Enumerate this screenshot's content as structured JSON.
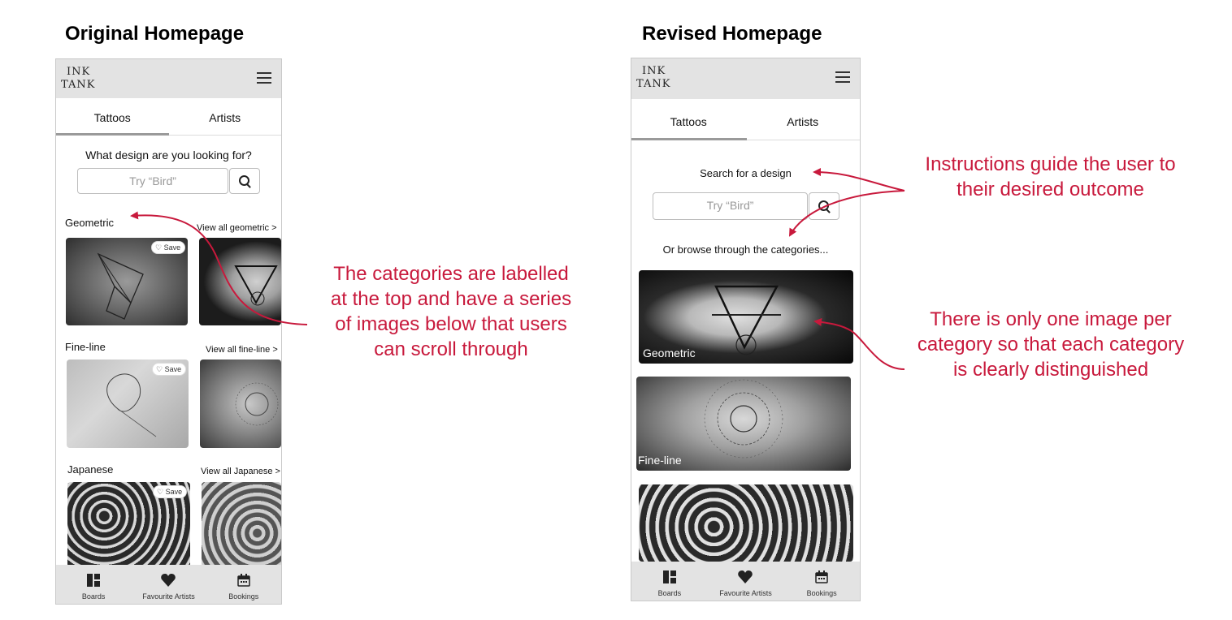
{
  "headings": {
    "original": "Original Homepage",
    "revised": "Revised Homepage"
  },
  "app": {
    "logo_line1": "INK",
    "logo_line2": "TANK",
    "menu_icon": "hamburger-menu-icon",
    "tabs": [
      "Tattoos",
      "Artists"
    ],
    "bottom_nav": [
      {
        "label": "Boards",
        "icon": "boards-grid-icon"
      },
      {
        "label": "Favourite Artists",
        "icon": "heart-icon"
      },
      {
        "label": "Bookings",
        "icon": "calendar-icon"
      }
    ]
  },
  "original": {
    "prompt": "What design are you looking for?",
    "search_placeholder": "Try “Bird”",
    "save_label": "Save",
    "categories": [
      {
        "name": "Geometric",
        "view_all": "View all geometric >"
      },
      {
        "name": "Fine-line",
        "view_all": "View all fine-line >"
      },
      {
        "name": "Japanese",
        "view_all": "View all Japanese >"
      }
    ]
  },
  "revised": {
    "prompt": "Search for a design",
    "search_placeholder": "Try “Bird”",
    "browse_text": "Or browse through the categories...",
    "cards": [
      "Geometric",
      "Fine-line",
      ""
    ]
  },
  "annotations": {
    "categories_note": "The categories are labelled at the top and have a series of images below that users can scroll through",
    "instructions_note": "Instructions guide the user to their desired outcome",
    "one_image_note": "There is only one image per category so that each category is clearly distinguished"
  },
  "colors": {
    "annotation": "#c8193c",
    "bars": "#e3e3e3"
  }
}
